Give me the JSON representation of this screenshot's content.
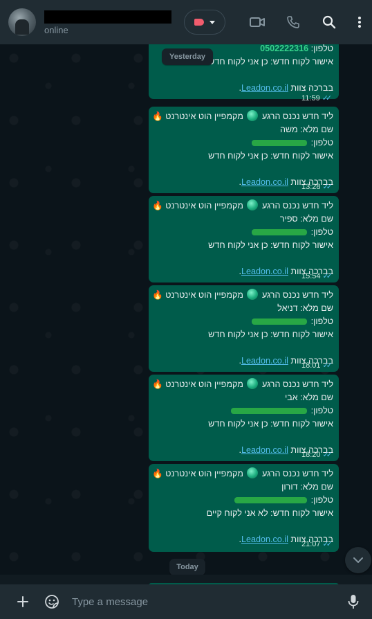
{
  "header": {
    "status": "online",
    "label_color": "#f15c6d"
  },
  "icons": {
    "video": "video-icon",
    "call": "phone-icon",
    "search": "search-icon",
    "menu": "more-vertical-icon"
  },
  "date_chips": {
    "yesterday": "Yesterday",
    "today": "Today"
  },
  "messages": [
    {
      "phone_label": "טלפון:",
      "phone_value": "0502222316",
      "approval": "אישור לקוח חדש: כן אני לקוח חדש",
      "sign_off": "בברכה צוות",
      "link": "Leadon.co.il",
      "link_suffix": ".",
      "time": "11:59"
    },
    {
      "headline": "ליד חדש נכנס הרגע",
      "campaign": "מקמפיין הוט אינטרנט",
      "name_line": "שם מלא: משה",
      "phone_label": "טלפון:",
      "approval": "אישור לקוח חדש: כן אני לקוח חדש",
      "sign_off": "בברכה צוות",
      "link": "Leadon.co.il",
      "link_suffix": ".",
      "time": "13:28"
    },
    {
      "headline": "ליד חדש נכנס הרגע",
      "campaign": "מקמפיין הוט אינטרנט",
      "name_line": "שם מלא: ספיר",
      "phone_label": "טלפון:",
      "approval": "אישור לקוח חדש: כן אני לקוח חדש",
      "sign_off": "בברכה צוות",
      "link": "Leadon.co.il",
      "link_suffix": ".",
      "time": "15:54"
    },
    {
      "headline": "ליד חדש נכנס הרגע",
      "campaign": "מקמפיין הוט אינטרנט",
      "name_line": "שם מלא: דניאל",
      "phone_label": "טלפון:",
      "approval": "אישור לקוח חדש: כן אני לקוח חדש",
      "sign_off": "בברכה צוות",
      "link": "Leadon.co.il",
      "link_suffix": ".",
      "time": "18:01"
    },
    {
      "headline": "ליד חדש נכנס הרגע",
      "campaign": "מקמפיין הוט אינטרנט",
      "name_line": "שם מלא: אבי",
      "phone_label": "טלפון:",
      "approval": "אישור לקוח חדש: כן אני לקוח חדש",
      "sign_off": "בברכה צוות",
      "link": "Leadon.co.il",
      "link_suffix": ".",
      "time": "18:20"
    },
    {
      "headline": "ליד חדש נכנס הרגע",
      "campaign": "מקמפיין הוט אינטרנט",
      "name_line": "שם מלא: דורון",
      "phone_label": "טלפון:",
      "approval": "אישור לקוח חדש: לא אני לקוח קיים",
      "sign_off": "בברכה צוות",
      "link": "Leadon.co.il",
      "link_suffix": ".",
      "time": "21:07"
    }
  ],
  "composer": {
    "placeholder": "Type a message"
  },
  "colors": {
    "outgoing_bubble": "#005c4b",
    "read_ticks": "#53bdeb",
    "link": "#53bdeb"
  }
}
